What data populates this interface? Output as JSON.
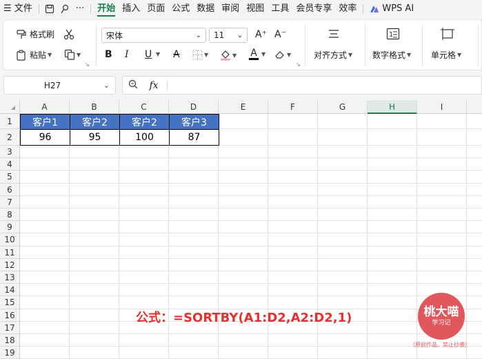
{
  "menu": {
    "hamburger_label": "☰ 文件",
    "items": [
      "开始",
      "插入",
      "页面",
      "公式",
      "数据",
      "审阅",
      "视图",
      "工具",
      "会员专享",
      "效率"
    ],
    "active": "开始",
    "wps_ai": "WPS AI",
    "more": "···"
  },
  "ribbon": {
    "format_painter": "格式刷",
    "paste": "粘贴",
    "font_name": "宋体",
    "font_size": "11",
    "bold": "B",
    "italic": "I",
    "underline": "U",
    "strike": "A",
    "font_color_glyph": "A",
    "increase_font": "A⁺",
    "decrease_font": "A⁻",
    "align_label": "对齐方式",
    "number_format_label": "数字格式",
    "cell_label": "单元格",
    "accent_color": "#1a7f4b"
  },
  "formula_bar": {
    "name_box": "H27",
    "fx_label": "fx",
    "formula": ""
  },
  "sheet": {
    "columns": [
      "A",
      "B",
      "C",
      "D",
      "E",
      "F",
      "G",
      "H",
      "I"
    ],
    "selected_column": "H",
    "rows": [
      "1",
      "2",
      "3",
      "4",
      "5",
      "6",
      "7",
      "8",
      "9",
      "10",
      "11",
      "12",
      "13",
      "14",
      "15",
      "16",
      "17",
      "18",
      "19"
    ],
    "header_fill": "#4472c4",
    "row1": [
      "客户1",
      "客户2",
      "客户2",
      "客户3"
    ],
    "row2": [
      "96",
      "95",
      "100",
      "87"
    ]
  },
  "annotation": {
    "formula_text": "公式：=SORTBY(A1:D2,A2:D2,1)",
    "color": "#e53030"
  },
  "watermark": {
    "title": "桃大喵",
    "subtitle": "学习记",
    "note": "（原创作品，禁止抄袭）"
  }
}
